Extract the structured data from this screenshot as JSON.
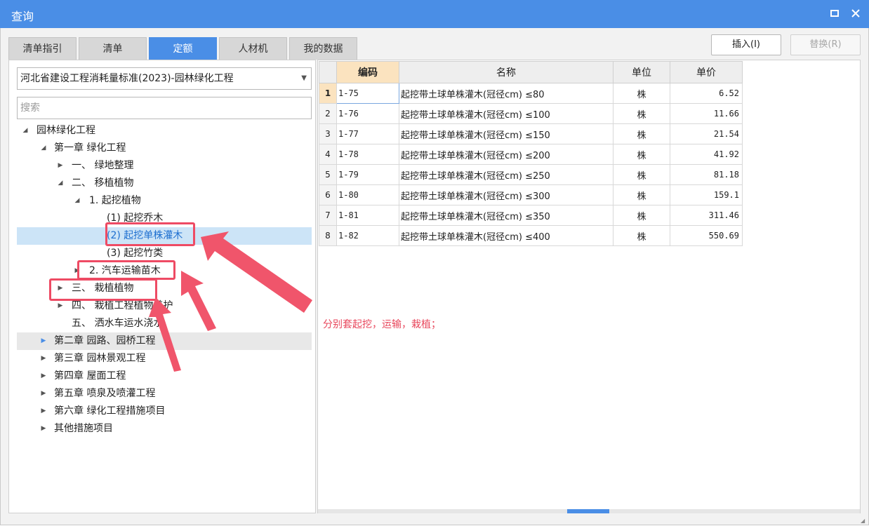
{
  "window": {
    "title": "查询"
  },
  "tabs": [
    {
      "label": "清单指引",
      "active": false
    },
    {
      "label": "清单",
      "active": false
    },
    {
      "label": "定额",
      "active": true
    },
    {
      "label": "人材机",
      "active": false
    },
    {
      "label": "我的数据",
      "active": false
    }
  ],
  "toolbar": {
    "insert_label": "插入(I)",
    "replace_label": "替换(R)"
  },
  "library_select": {
    "value": "河北省建设工程消耗量标准(2023)-园林绿化工程"
  },
  "search": {
    "placeholder": "搜索"
  },
  "tree": [
    {
      "label": "园林绿化工程",
      "arrow": "expanded",
      "level": 0
    },
    {
      "label": "第一章 绿化工程",
      "arrow": "expanded",
      "level": 1
    },
    {
      "label": "一、 绿地整理",
      "arrow": "collapsed",
      "level": 2
    },
    {
      "label": "二、 移植植物",
      "arrow": "expanded",
      "level": 2
    },
    {
      "label": "1. 起挖植物",
      "arrow": "expanded",
      "level": 3
    },
    {
      "label": "(1) 起挖乔木",
      "arrow": "none",
      "level": 4
    },
    {
      "label": "(2) 起挖单株灌木",
      "arrow": "none",
      "level": 4,
      "selected": true
    },
    {
      "label": "(3) 起挖竹类",
      "arrow": "none",
      "level": 4
    },
    {
      "label": "2. 汽车运输苗木",
      "arrow": "collapsed",
      "level": 3
    },
    {
      "label": "三、 栽植植物",
      "arrow": "collapsed",
      "level": 2
    },
    {
      "label": "四、 栽植工程植物养护",
      "arrow": "collapsed",
      "level": 2
    },
    {
      "label": "五、 洒水车运水浇水",
      "arrow": "none",
      "level": 2
    },
    {
      "label": "第二章 园路、园桥工程",
      "arrow": "collapsed",
      "level": 1,
      "hover": true
    },
    {
      "label": "第三章 园林景观工程",
      "arrow": "collapsed",
      "level": 1
    },
    {
      "label": "第四章 屋面工程",
      "arrow": "collapsed",
      "level": 1
    },
    {
      "label": "第五章 喷泉及喷灌工程",
      "arrow": "collapsed",
      "level": 1
    },
    {
      "label": "第六章 绿化工程措施项目",
      "arrow": "collapsed",
      "level": 1
    },
    {
      "label": "其他措施项目",
      "arrow": "collapsed",
      "level": 1
    }
  ],
  "grid": {
    "columns": [
      "编码",
      "名称",
      "单位",
      "单价"
    ],
    "rows": [
      {
        "idx": "1",
        "code": "1-75",
        "name": "起挖带土球单株灌木(冠径cm) ≤80",
        "unit": "株",
        "price": "6.52"
      },
      {
        "idx": "2",
        "code": "1-76",
        "name": "起挖带土球单株灌木(冠径cm) ≤100",
        "unit": "株",
        "price": "11.66"
      },
      {
        "idx": "3",
        "code": "1-77",
        "name": "起挖带土球单株灌木(冠径cm) ≤150",
        "unit": "株",
        "price": "21.54"
      },
      {
        "idx": "4",
        "code": "1-78",
        "name": "起挖带土球单株灌木(冠径cm) ≤200",
        "unit": "株",
        "price": "41.92"
      },
      {
        "idx": "5",
        "code": "1-79",
        "name": "起挖带土球单株灌木(冠径cm) ≤250",
        "unit": "株",
        "price": "81.18"
      },
      {
        "idx": "6",
        "code": "1-80",
        "name": "起挖带土球单株灌木(冠径cm) ≤300",
        "unit": "株",
        "price": "159.1"
      },
      {
        "idx": "7",
        "code": "1-81",
        "name": "起挖带土球单株灌木(冠径cm) ≤350",
        "unit": "株",
        "price": "311.46"
      },
      {
        "idx": "8",
        "code": "1-82",
        "name": "起挖带土球单株灌木(冠径cm) ≤400",
        "unit": "株",
        "price": "550.69"
      }
    ]
  },
  "annotation": {
    "text": "分别套起挖，运输，栽植；"
  },
  "colors": {
    "accent": "#4a8ee6",
    "annotation": "#ee4b64",
    "selected_row": "#cce4f7",
    "code_header": "#fbe3bf"
  }
}
